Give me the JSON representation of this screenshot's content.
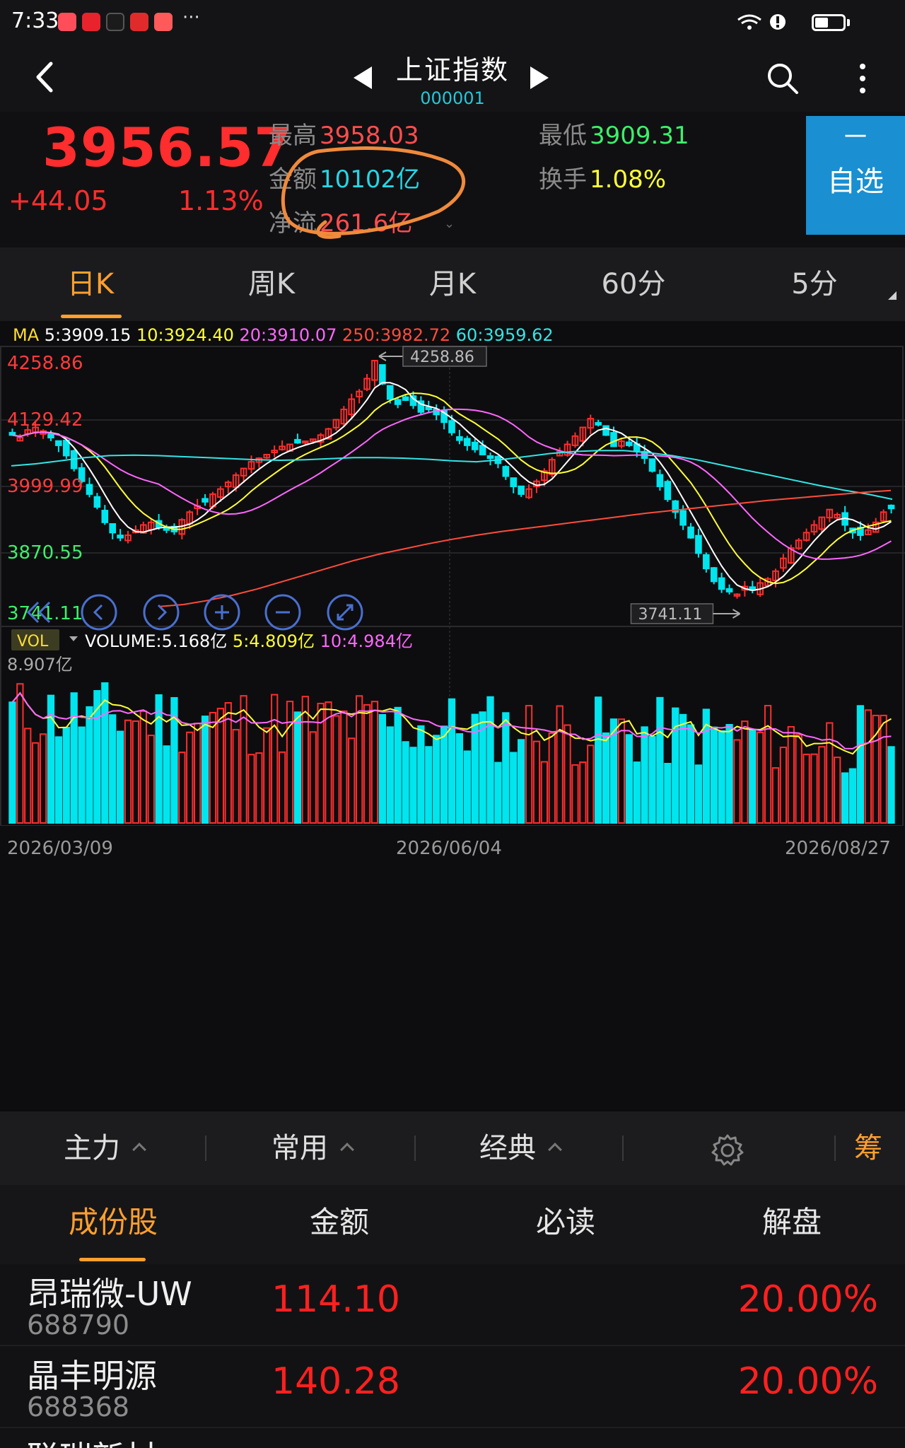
{
  "status_bar": {
    "time": "7:33",
    "more": "···"
  },
  "nav": {
    "title": "上证指数",
    "code": "000001"
  },
  "quote": {
    "price": "3956.57",
    "change": "+44.05",
    "change_pct": "1.13%",
    "high_label": "最高",
    "high_value": "3958.03",
    "low_label": "最低",
    "low_value": "3909.31",
    "amount_label": "金额",
    "amount_value": "10102亿",
    "turnover_label": "换手",
    "turnover_value": "1.08%",
    "netflow_label": "净流",
    "netflow_value": "261.6亿",
    "favorite_minus": "－",
    "favorite_label": "自选"
  },
  "period_tabs": [
    {
      "label": "日K",
      "active": true
    },
    {
      "label": "周K",
      "active": false
    },
    {
      "label": "月K",
      "active": false
    },
    {
      "label": "60分",
      "active": false
    },
    {
      "label": "5分",
      "active": false
    }
  ],
  "colors": {
    "up": "#ff2d2d",
    "down": "#00e5ee",
    "accent": "#ff9f2e",
    "ma5": "#ffffff",
    "ma10": "#ffff33",
    "ma20": "#ff66ff",
    "ma250": "#ff4c3b",
    "ma60": "#33e5e5"
  },
  "chart_data": {
    "type": "candlestick",
    "ma_label": "MA",
    "ma_legend": [
      {
        "name": "5",
        "value": "3909.15",
        "color": "#ffffff"
      },
      {
        "name": "10",
        "value": "3924.40",
        "color": "#ffff33"
      },
      {
        "name": "20",
        "value": "3910.07",
        "color": "#ff66ff"
      },
      {
        "name": "250",
        "value": "3982.72",
        "color": "#ff4c3b"
      },
      {
        "name": "60",
        "value": "3959.62",
        "color": "#33e5e5"
      }
    ],
    "y_axis_labels": [
      "4258.86",
      "4129.42",
      "3999.99",
      "3870.55",
      "3741.11"
    ],
    "ylim": [
      3741.11,
      4258.86
    ],
    "max_marker": "4258.86",
    "min_marker": "3741.11",
    "x_labels": [
      "2026/03/09",
      "2026/06/04",
      "2026/08/27"
    ],
    "close_path": [
      4100,
      4095,
      4110,
      4115,
      4108,
      4095,
      4080,
      4060,
      4035,
      4010,
      3985,
      3960,
      3930,
      3910,
      3900,
      3905,
      3915,
      3925,
      3930,
      3920,
      3915,
      3912,
      3935,
      3950,
      3962,
      3970,
      3985,
      3995,
      4008,
      4022,
      4035,
      4048,
      4055,
      4062,
      4070,
      4078,
      4082,
      4085,
      4088,
      4092,
      4100,
      4112,
      4130,
      4150,
      4170,
      4185,
      4210,
      4245,
      4200,
      4170,
      4160,
      4168,
      4158,
      4145,
      4150,
      4140,
      4125,
      4105,
      4090,
      4080,
      4072,
      4062,
      4055,
      4045,
      4020,
      4000,
      3985,
      3995,
      4010,
      4030,
      4052,
      4068,
      4082,
      4098,
      4115,
      4132,
      4120,
      4100,
      4078,
      4088,
      4080,
      4070,
      4055,
      4030,
      4000,
      3975,
      3950,
      3925,
      3900,
      3870,
      3840,
      3815,
      3800,
      3795,
      3790,
      3805,
      3798,
      3812,
      3820,
      3835,
      3860,
      3880,
      3895,
      3910,
      3925,
      3940,
      3955,
      3945,
      3925,
      3910,
      3905,
      3915,
      3930,
      3950,
      3957
    ],
    "ma250_path": [
      3766,
      3770,
      3778,
      3788,
      3800,
      3814,
      3828,
      3842,
      3856,
      3868,
      3878,
      3888,
      3897,
      3905,
      3912,
      3918,
      3924,
      3930,
      3936,
      3942,
      3948,
      3953,
      3958,
      3963,
      3968,
      3973,
      3977,
      3981,
      3985,
      3989,
      3992
    ],
    "ma60_path": [
      4040,
      4044,
      4050,
      4056,
      4060,
      4061,
      4060,
      4058,
      4056,
      4054,
      4052,
      4051,
      4052,
      4054,
      4056,
      4056,
      4055,
      4053,
      4050,
      4048,
      4052,
      4058,
      4064,
      4068,
      4070,
      4070,
      4066,
      4060,
      4052,
      4042,
      4032,
      4022,
      4012,
      4002,
      3993,
      3985,
      3975
    ],
    "volume_legend": {
      "label": "VOL",
      "total": "VOLUME:5.168亿",
      "ma5": "5:4.809亿",
      "ma10": "10:4.984亿"
    },
    "volume_axis_label": "8.907亿"
  },
  "indicator_tabs": [
    {
      "label": "主力"
    },
    {
      "label": "常用"
    },
    {
      "label": "经典"
    }
  ],
  "chou_label": "筹",
  "list_tabs": [
    {
      "label": "成份股",
      "active": true
    },
    {
      "label": "金额",
      "active": false
    },
    {
      "label": "必读",
      "active": false
    },
    {
      "label": "解盘",
      "active": false
    }
  ],
  "stocks": [
    {
      "name": "昂瑞微-UW",
      "code": "688790",
      "price": "114.10",
      "pct": "20.00%"
    },
    {
      "name": "晶丰明源",
      "code": "688368",
      "price": "140.28",
      "pct": "20.00%"
    },
    {
      "name": "联瑞新材",
      "code": "",
      "price": "",
      "pct": ""
    }
  ]
}
